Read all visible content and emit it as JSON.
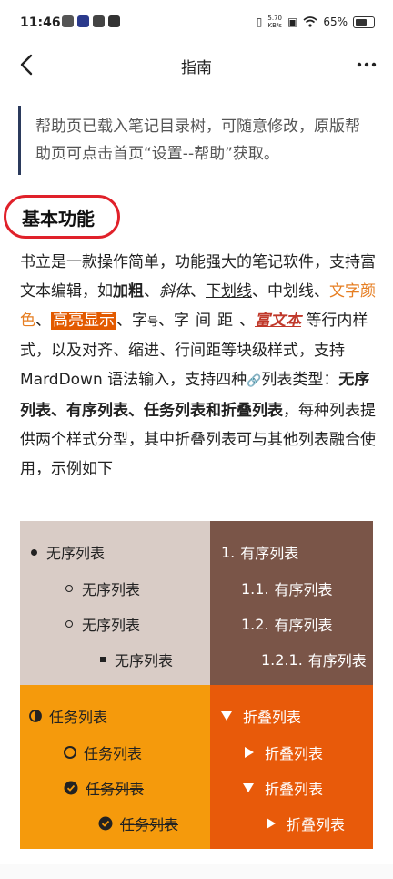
{
  "status_bar": {
    "time": "11:46",
    "speed_value": "5.70",
    "speed_unit": "KB/s",
    "battery": "65%"
  },
  "header": {
    "title": "指南"
  },
  "notice": {
    "text": "帮助页已载入笔记目录树，可随意修改，原版帮助页可点击首页“设置--帮助”获取。"
  },
  "section": {
    "heading": "基本功能"
  },
  "body": {
    "p1": "书立是一款操作简单，功能强大的笔记软件，支持富文本编辑，如",
    "bold": "加粗",
    "sep1": "、",
    "italic": "斜体",
    "sep2": "、",
    "underline": "下划线",
    "sep3": "、",
    "strike": "中划线",
    "sep4": "、",
    "colored": "文字颜色",
    "sep5": "、",
    "highlight": "高亮显示",
    "sep6": "、字",
    "small": "号",
    "sep7": "、",
    "spacing": "字间距",
    "sep8": "、",
    "richtext": "富文本",
    "p2": " 等行内样式，以及对齐、缩进、行间距等块级样式，支持 MardDown 语法输入，支持四种",
    "link_icon": "🔗",
    "p3": "列表类型：",
    "list_types": "无序列表、有序列表、任务列表和折叠列表",
    "p4": "，每种列表提供两个样式分型，其中折叠列表可与其他列表融合使用，示例如下"
  },
  "unordered_list": {
    "items": [
      "无序列表",
      "无序列表",
      "无序列表",
      "无序列表"
    ]
  },
  "ordered_list": {
    "items": [
      {
        "marker": "1.",
        "text": "有序列表"
      },
      {
        "marker": "1.1.",
        "text": "有序列表"
      },
      {
        "marker": "1.2.",
        "text": "有序列表"
      },
      {
        "marker": "1.2.1.",
        "text": "有序列表"
      }
    ]
  },
  "task_list": {
    "items": [
      "任务列表",
      "任务列表",
      "任务列表",
      "任务列表"
    ]
  },
  "fold_list": {
    "items": [
      "折叠列表",
      "折叠列表",
      "折叠列表",
      "折叠列表"
    ]
  },
  "colors": {
    "ul_bg": "#d9ccc6",
    "ol_bg": "#7a5548",
    "task_bg": "#f59a0c",
    "fold_bg": "#e85a0a",
    "highlight": "#e35a00",
    "circle_red": "#e0212a"
  }
}
